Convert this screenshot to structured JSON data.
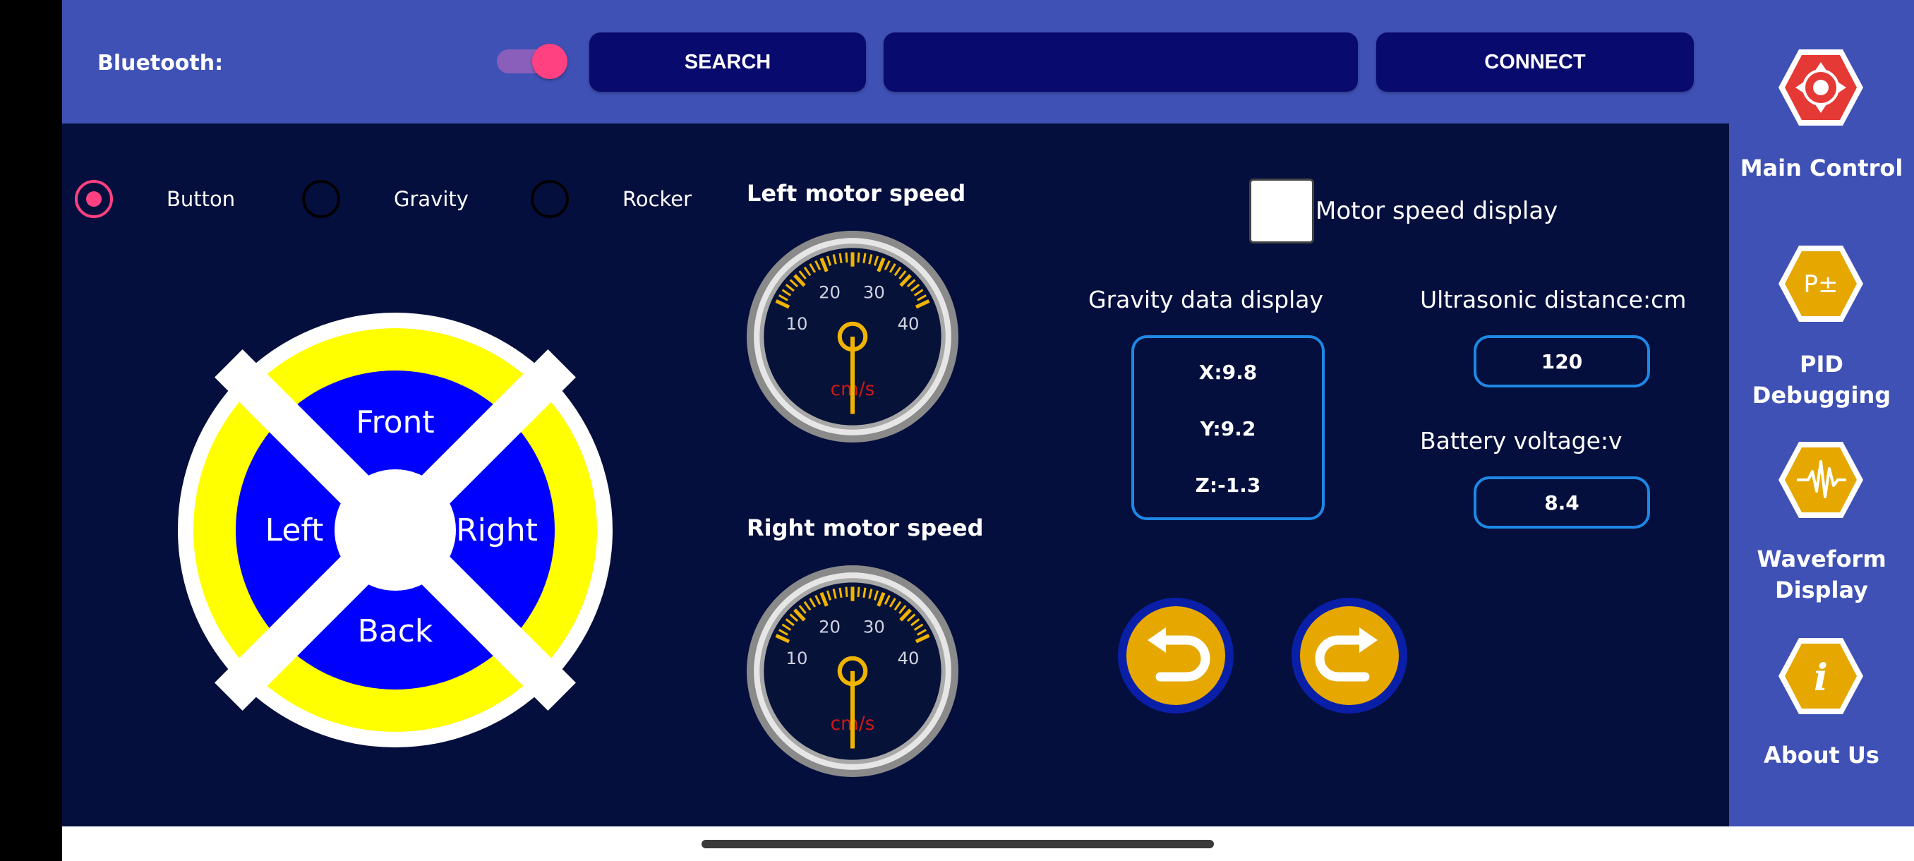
{
  "bluetooth": {
    "label": "Bluetooth:",
    "toggle_on": true,
    "search_label": "SEARCH",
    "device_field": "",
    "connect_label": "CONNECT"
  },
  "modes": [
    {
      "label": "Button",
      "selected": true
    },
    {
      "label": "Gravity",
      "selected": false
    },
    {
      "label": "Rocker",
      "selected": false
    }
  ],
  "dpad": {
    "front": "Front",
    "left": "Left",
    "right": "Right",
    "back": "Back"
  },
  "left_motor": {
    "title": "Left motor speed",
    "ticks": [
      "10",
      "20",
      "30",
      "40"
    ],
    "unit": "cm/s"
  },
  "right_motor": {
    "title": "Right motor speed",
    "ticks": [
      "10",
      "20",
      "30",
      "40"
    ],
    "unit": "cm/s"
  },
  "motor_display": {
    "label": "Motor speed display",
    "checked": false
  },
  "gravity": {
    "title": "Gravity data display",
    "x": "X:9.8",
    "y": "Y:9.2",
    "z": "Z:-1.3"
  },
  "ultrasonic": {
    "title": "Ultrasonic distance:cm",
    "value": "120"
  },
  "battery": {
    "title": "Battery voltage:v",
    "value": "8.4"
  },
  "nav": [
    {
      "label": "Main Control",
      "icon": "dpad-icon",
      "color": "#e53935"
    },
    {
      "label": "PID Debugging",
      "icon": "pid-icon",
      "color": "#e6a800"
    },
    {
      "label": "Waveform Display",
      "icon": "waveform-icon",
      "color": "#e6a800"
    },
    {
      "label": "About Us",
      "icon": "info-icon",
      "color": "#e6a800"
    }
  ],
  "colors": {
    "topbar": "#3f51b5",
    "panel": "#050f3d",
    "accent": "#ff4081",
    "button": "#080a6e",
    "dpad_blue": "#0000ff",
    "dpad_yellow": "#ffff00",
    "box_border": "#1e88e5"
  }
}
